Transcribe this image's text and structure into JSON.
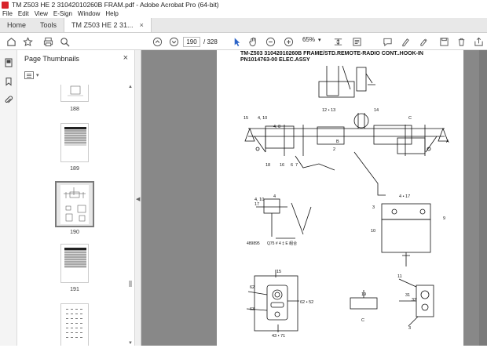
{
  "window": {
    "title": "TM Z503 HE  2 31042010260B FRAM.pdf - Adobe Acrobat Pro (64-bit)"
  },
  "menu": [
    "File",
    "Edit",
    "View",
    "E-Sign",
    "Window",
    "Help"
  ],
  "tabs": [
    {
      "label": "Home"
    },
    {
      "label": "Tools"
    },
    {
      "label": "TM Z503 HE  2 31...",
      "close": "×"
    }
  ],
  "toolbar": {
    "page_current": "190",
    "page_total": "/ 328",
    "zoom": "65%"
  },
  "sidebar": {
    "title": "Page Thumbnails",
    "close": "×",
    "thumbs": [
      {
        "label": "188"
      },
      {
        "label": "189"
      },
      {
        "label": "190"
      },
      {
        "label": "191"
      }
    ]
  },
  "document": {
    "title_line1": "TM-Z503 31042010260B FRAME/STD.REMOTE-RADIO CONT..HOOK-IN",
    "title_line2": "PN1014763-00 ELEC.ASSY",
    "callouts": [
      "15",
      "4",
      "10",
      "4,8",
      "5",
      "3",
      "12·13",
      "14",
      "C",
      "A",
      "17",
      "1",
      "B",
      "2",
      "18",
      "6",
      "7",
      "11",
      "16",
      "19",
      "9",
      "4·17",
      "3",
      "10",
      "7",
      "4",
      "4",
      "17",
      "8",
      "3",
      "489895",
      "15",
      "62",
      "63",
      "62·52",
      "43·71",
      "19",
      "C",
      "11",
      "31",
      "32",
      "3"
    ]
  }
}
